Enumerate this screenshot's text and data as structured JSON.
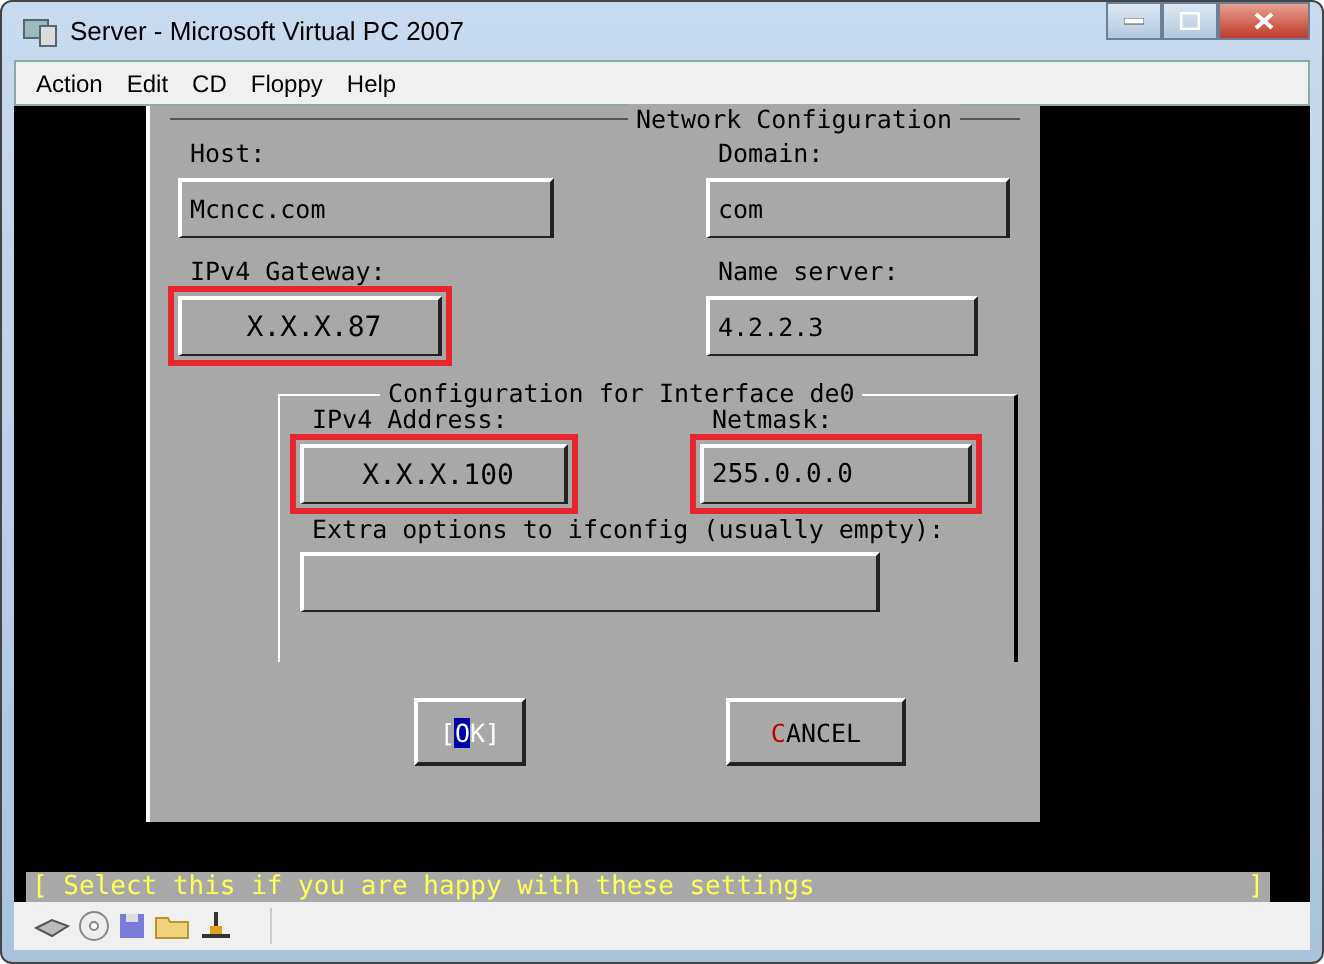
{
  "window": {
    "title": "Server - Microsoft Virtual PC 2007"
  },
  "menu": [
    "Action",
    "Edit",
    "CD",
    "Floppy",
    "Help"
  ],
  "dialog": {
    "title": "Network Configuration",
    "fields": [
      {
        "label": "Host:",
        "value": "Mcncc.com",
        "highlighted": false
      },
      {
        "label": "Domain:",
        "value": "com",
        "highlighted": false
      },
      {
        "label": "IPv4 Gateway:",
        "value": "X.X.X.87",
        "highlighted": true
      },
      {
        "label": "Name server:",
        "value": "4.2.2.3",
        "highlighted": false
      }
    ],
    "interface": {
      "title": "Configuration for Interface de0",
      "fields": [
        {
          "label": "IPv4 Address:",
          "value": "X.X.X.100",
          "highlighted": true
        },
        {
          "label": "Netmask:",
          "value": "255.0.0.0",
          "highlighted": true
        }
      ],
      "extra": {
        "label": "Extra options to ifconfig (usually empty):"
      }
    },
    "buttons": [
      {
        "open": "[",
        "label": "OK",
        "close": "]",
        "selected": true
      },
      {
        "label": "CANCEL",
        "selected": false
      }
    ]
  },
  "status_line": {
    "text": "[ Select this if you are happy with these settings",
    "end": "]"
  }
}
